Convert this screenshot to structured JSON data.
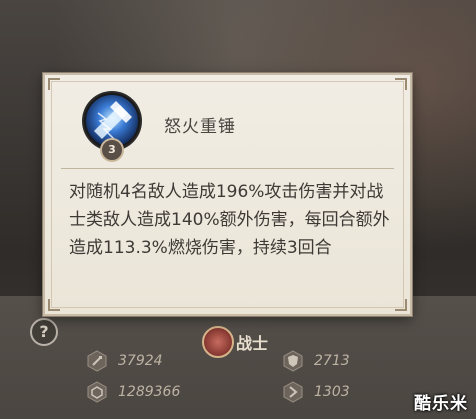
{
  "tooltip": {
    "skill_name": "怒火重锤",
    "skill_level": "3",
    "description": "对随机4名敌人造成196%攻击伤害并对战士类敌人造成140%额外伤害，每回合额外造成113.3%燃烧伤害，持续3回合"
  },
  "background": {
    "help_label": "?",
    "class_label": "战士",
    "stats": [
      {
        "icon": "attack-icon",
        "value": "37924"
      },
      {
        "icon": "defense-icon",
        "value": "2713"
      },
      {
        "icon": "hp-icon",
        "value": "1289366"
      },
      {
        "icon": "speed-icon",
        "value": "1303"
      }
    ]
  },
  "watermark": "酷乐米",
  "colors": {
    "tooltip_bg": "#ede8dd",
    "tooltip_border": "#c8bca8",
    "text_dark": "#3e3935",
    "icon_blue": "#3a7bd5"
  }
}
